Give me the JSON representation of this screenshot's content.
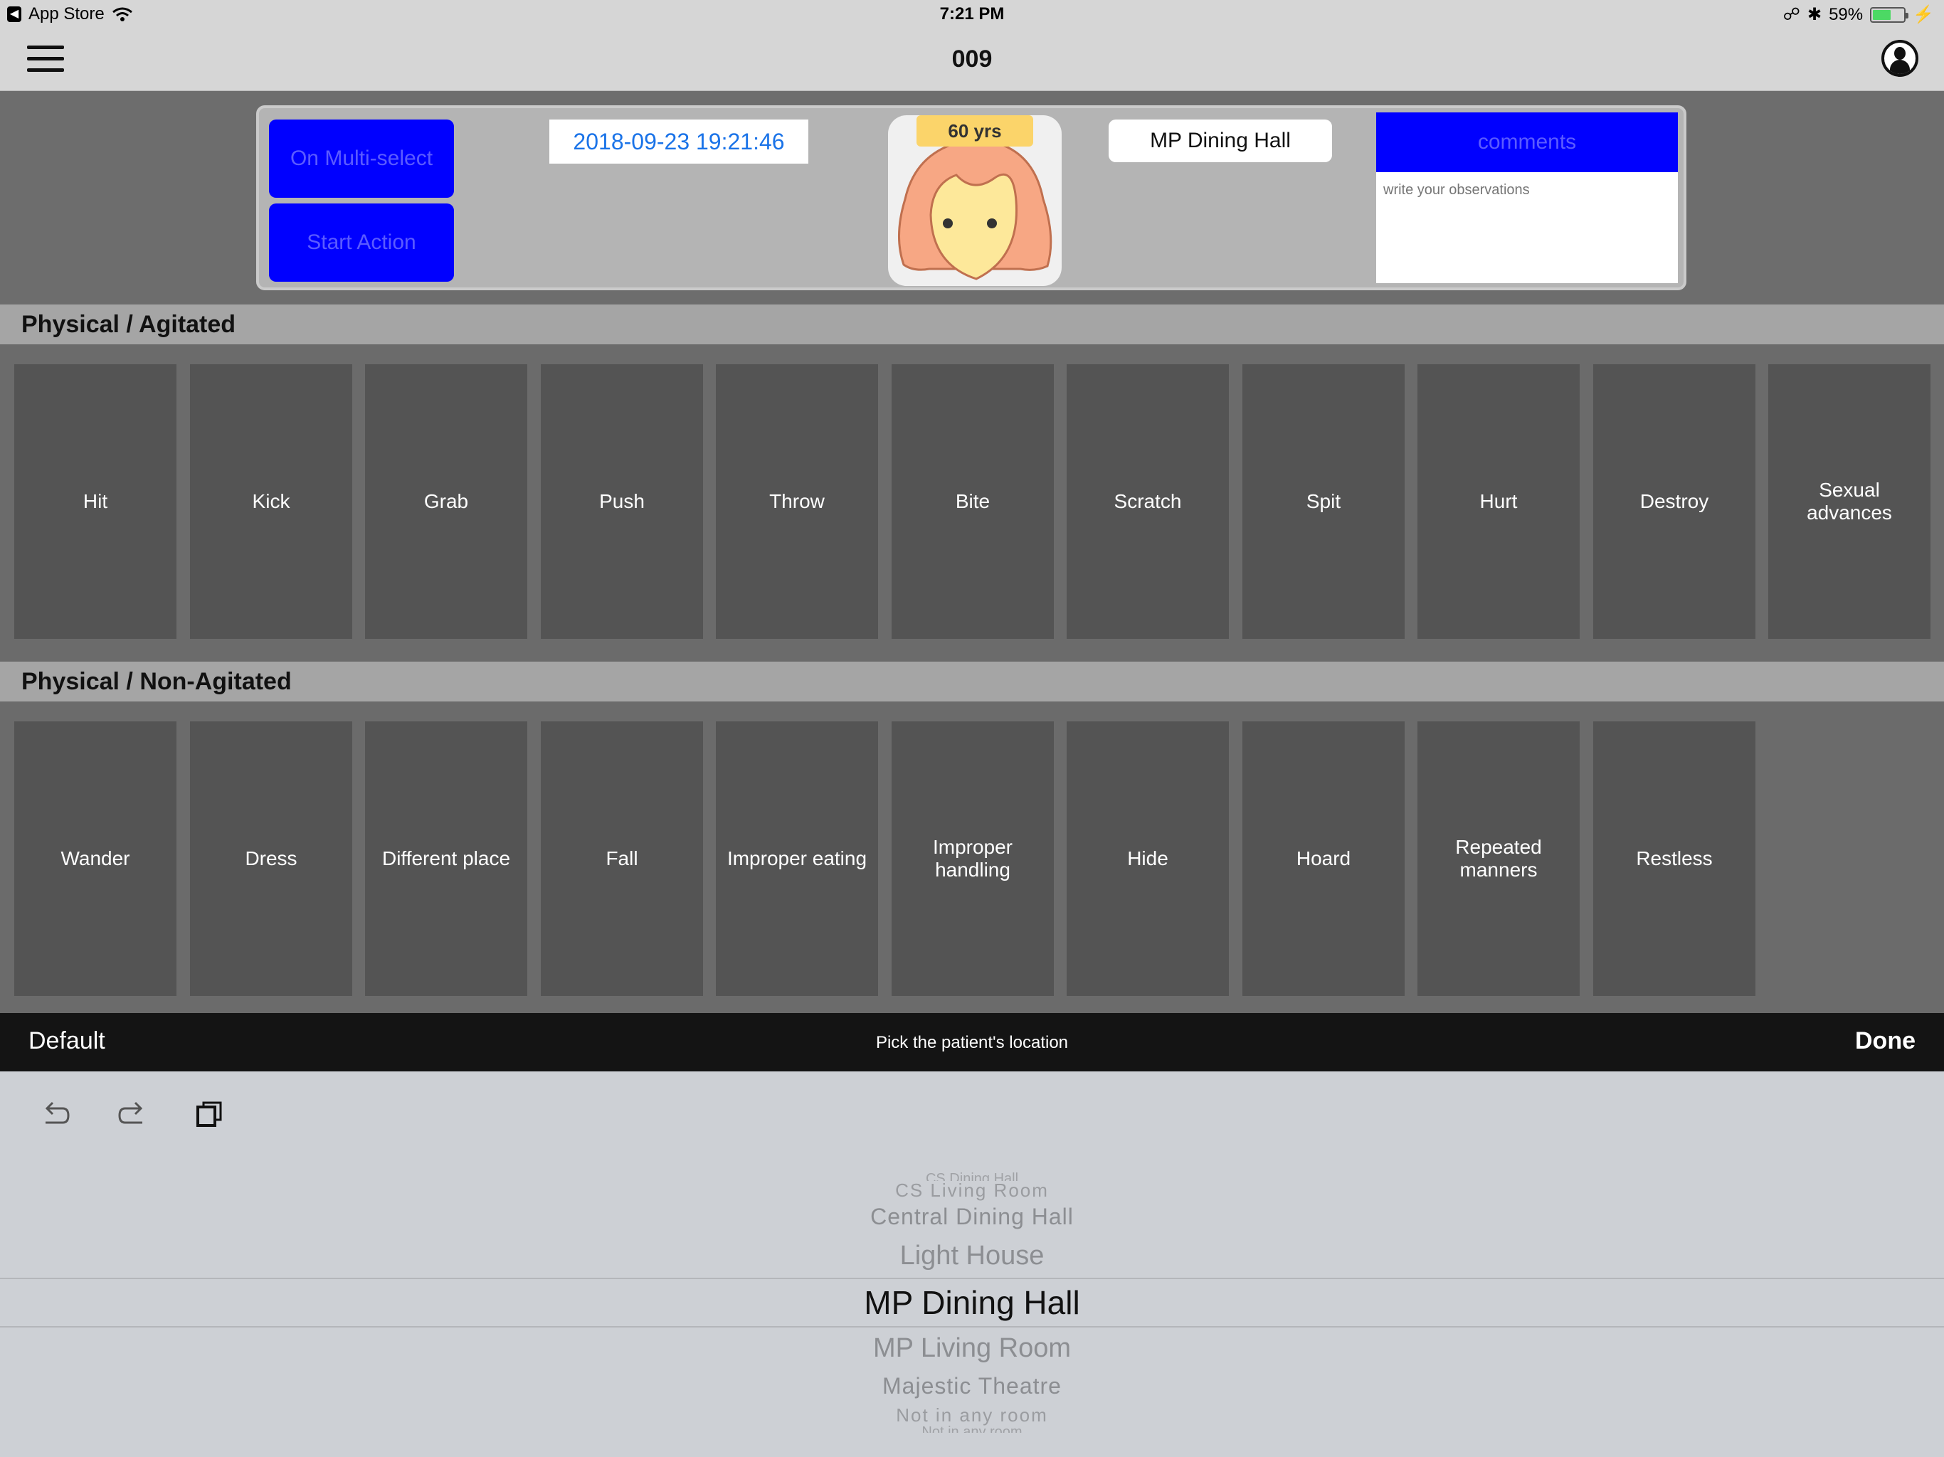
{
  "status_bar": {
    "back_app": "App Store",
    "time": "7:21 PM",
    "battery_percent": "59%",
    "battery_level": 0.59
  },
  "nav": {
    "title": "009"
  },
  "header": {
    "multi_select_label": "On Multi-select",
    "start_action_label": "Start Action",
    "datetime": "2018-09-23 19:21:46",
    "age_badge": "60 yrs",
    "location": "MP Dining Hall",
    "comments_label": "comments",
    "comments_placeholder": "write your observations"
  },
  "sections": [
    {
      "title": "Physical / Agitated",
      "tiles": [
        "Hit",
        "Kick",
        "Grab",
        "Push",
        "Throw",
        "Bite",
        "Scratch",
        "Spit",
        "Hurt",
        "Destroy",
        "Sexual advances"
      ]
    },
    {
      "title": "Physical / Non-Agitated",
      "tiles": [
        "Wander",
        "Dress",
        "Different place",
        "Fall",
        "Improper eating",
        "Improper handling",
        "Hide",
        "Hoard",
        "Repeated manners",
        "Restless"
      ]
    }
  ],
  "picker_toolbar": {
    "default_label": "Default",
    "title": "Pick the patient's location",
    "done_label": "Done"
  },
  "picker": {
    "options": [
      "CS Dining Hall",
      "CS Living Room",
      "Central Dining Hall",
      "Light House",
      "MP Dining Hall",
      "MP Living Room",
      "Majestic Theatre",
      "Not in any room",
      "Not in any room"
    ],
    "selected": "MP Dining Hall"
  },
  "icons": {
    "menu": "hamburger-menu-icon",
    "profile": "user-profile-icon",
    "undo": "undo-icon",
    "redo": "redo-icon",
    "paste": "paste-icon"
  },
  "colors": {
    "accent_blue": "#0000ff",
    "date_text": "#1a73e8",
    "tile_bg": "#545454",
    "age_badge": "#fbd46a"
  }
}
